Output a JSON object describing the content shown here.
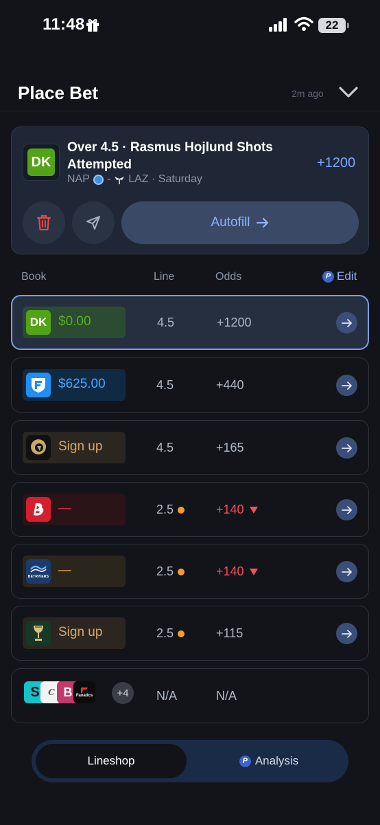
{
  "status_bar": {
    "time": "11:48",
    "battery": "22"
  },
  "header": {
    "title": "Place Bet",
    "updated": "2m ago"
  },
  "bet": {
    "book_abbr": "DK",
    "title": "Over 4.5 · Rasmus Hojlund Shots Attempted",
    "home_team": "NAP",
    "separator": "-",
    "away_team": "LAZ · Saturday",
    "odds": "+1200",
    "autofill_label": "Autofill"
  },
  "columns": {
    "book": "Book",
    "line": "Line",
    "odds": "Odds",
    "edit": "Edit",
    "edit_icon_letter": "P"
  },
  "rows": [
    {
      "book": "DraftKings",
      "logo_text": "DK",
      "label": "$0.00",
      "line": "4.5",
      "odds": "+1200"
    },
    {
      "book": "FanDuel",
      "label": "$625.00",
      "line": "4.5",
      "odds": "+440"
    },
    {
      "book": "BetMGM",
      "label": "Sign up",
      "line": "4.5",
      "odds": "+165"
    },
    {
      "book": "Bally Bet",
      "label": "—",
      "line": "2.5",
      "odds": "+140"
    },
    {
      "book": "BetRivers",
      "logo_text": "BETRIVERS",
      "label": "—",
      "line": "2.5",
      "odds": "+140"
    },
    {
      "book": "Golden Nugget",
      "label": "Sign up",
      "line": "2.5",
      "odds": "+115"
    },
    {
      "books_more": "+4",
      "line": "N/A",
      "odds": "N/A",
      "fanatics_text": "Fanatics"
    }
  ],
  "colors": {
    "accent": "#7ea7ff",
    "dk_green": "#53a317",
    "fanduel_blue": "#1f8ff0",
    "down_red": "#f0505a",
    "line_dot": "#f59a2f"
  },
  "bottom_nav": {
    "active": "Lineshop",
    "inactive": "Analysis",
    "icon_letter": "P"
  }
}
